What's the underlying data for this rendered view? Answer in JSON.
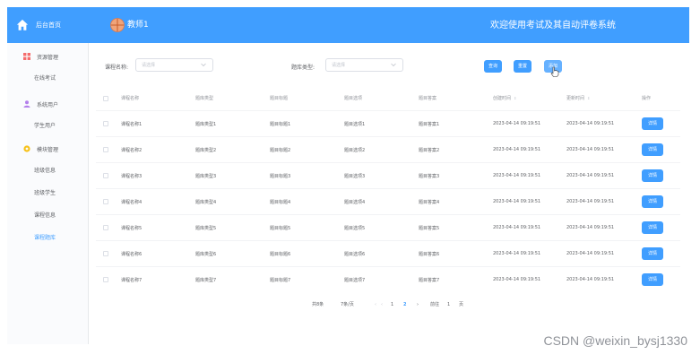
{
  "sidebar": {
    "brand": "后台首页",
    "groups": [
      {
        "title": "资源管理",
        "icon": "grid-icon",
        "color": "#f56c6c",
        "items": [
          "在线考试"
        ]
      },
      {
        "title": "系统用户",
        "icon": "user-icon",
        "color": "#b37feb",
        "items": [
          "学生用户"
        ]
      },
      {
        "title": "模块管理",
        "icon": "gear-icon",
        "color": "#f7c21b",
        "items": [
          "班级信息",
          "班级学生",
          "课程信息",
          "课程题库"
        ]
      }
    ],
    "active_item": "课程题库"
  },
  "header": {
    "user": "教师1",
    "title": "欢迎使用考试及其自动评卷系统"
  },
  "search": {
    "course_label": "课程名称:",
    "course_placeholder": "请选择",
    "type_label": "题库类型:",
    "type_placeholder": "请选择",
    "buttons": [
      "查询",
      "重置",
      "添加"
    ]
  },
  "table": {
    "columns": [
      "课程名称",
      "题库类型",
      "题目标题",
      "题目选项",
      "题目答案",
      "创建时间",
      "更新时间",
      "操作"
    ],
    "rows": [
      [
        "课程名称1",
        "题库类型1",
        "题目标题1",
        "题目选项1",
        "题目答案1",
        "2023-04-14 09:19:51",
        "2023-04-14 09:19:51",
        "详情"
      ],
      [
        "课程名称2",
        "题库类型2",
        "题目标题2",
        "题目选项2",
        "题目答案2",
        "2023-04-14 09:19:51",
        "2023-04-14 09:19:51",
        "详情"
      ],
      [
        "课程名称3",
        "题库类型3",
        "题目标题3",
        "题目选项3",
        "题目答案3",
        "2023-04-14 09:19:51",
        "2023-04-14 09:19:51",
        "详情"
      ],
      [
        "课程名称4",
        "题库类型4",
        "题目标题4",
        "题目选项4",
        "题目答案4",
        "2023-04-14 09:19:51",
        "2023-04-14 09:19:51",
        "详情"
      ],
      [
        "课程名称5",
        "题库类型5",
        "题目标题5",
        "题目选项5",
        "题目答案5",
        "2023-04-14 09:19:51",
        "2023-04-14 09:19:51",
        "详情"
      ],
      [
        "课程名称6",
        "题库类型6",
        "题目标题6",
        "题目选项6",
        "题目答案6",
        "2023-04-14 09:19:51",
        "2023-04-14 09:19:51",
        "详情"
      ],
      [
        "课程名称7",
        "题库类型7",
        "题目标题7",
        "题目选项7",
        "题目答案7",
        "2023-04-14 09:19:51",
        "2023-04-14 09:19:51",
        "详情"
      ]
    ]
  },
  "pager": {
    "total": "共8条",
    "page_size": "7条/页",
    "pages": [
      "1",
      "2"
    ],
    "current": "2",
    "goto_label": "前往",
    "goto_value": "1",
    "goto_suffix": "页"
  },
  "watermark": "CSDN @weixin_bysj1330",
  "colors": {
    "primary": "#409eff",
    "sidebar_bg": "#fafbfd"
  }
}
